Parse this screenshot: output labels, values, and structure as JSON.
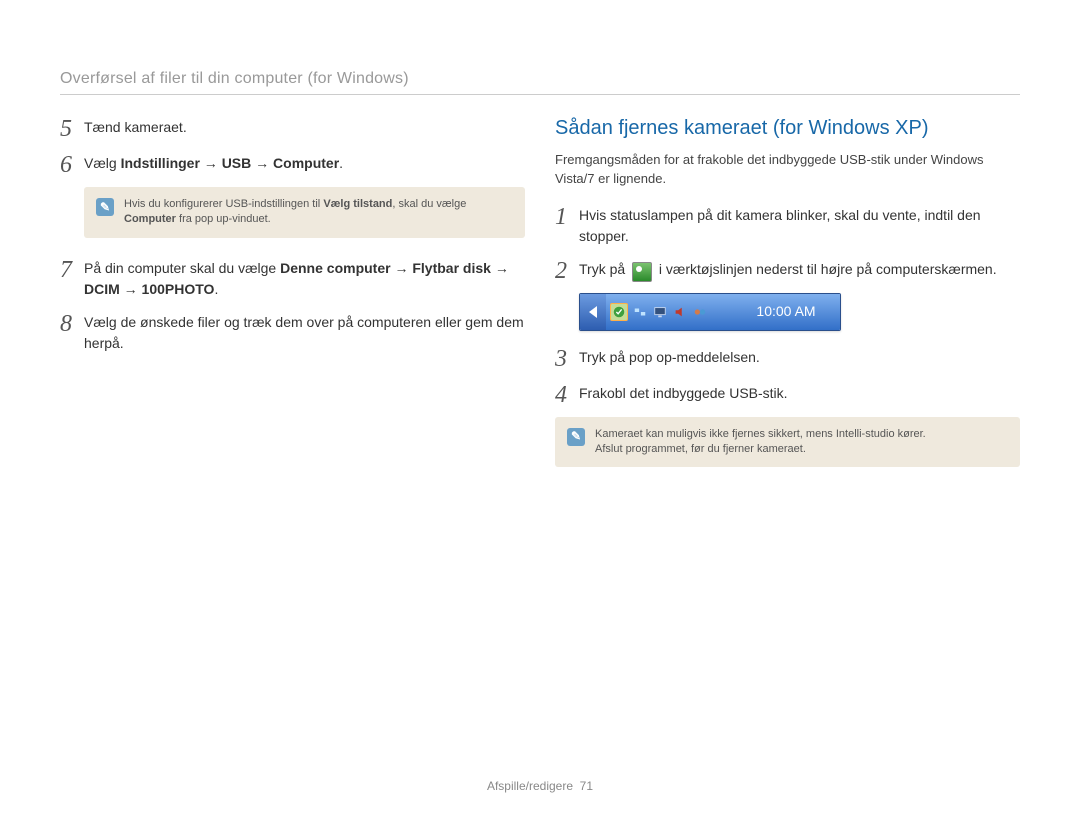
{
  "header": {
    "title": "Overførsel af filer til din computer (for Windows)"
  },
  "left": {
    "step5": {
      "num": "5",
      "text": "Tænd kameraet."
    },
    "step6": {
      "num": "6",
      "prefix": "Vælg ",
      "bold": "Indstillinger → USB → Computer",
      "suffix": "."
    },
    "note": {
      "line1a": "Hvis du konfigurerer USB-indstillingen til ",
      "line1b": "Vælg tilstand",
      "line1c": ", skal du vælge ",
      "line2a": "Computer",
      "line2b": " fra pop up-vinduet."
    },
    "step7": {
      "num": "7",
      "prefix": "På din computer skal du vælge ",
      "bold": "Denne computer → Flytbar disk → DCIM → 100PHOTO",
      "suffix": "."
    },
    "step8": {
      "num": "8",
      "text": "Vælg de ønskede filer og træk dem over på computeren eller gem dem herpå."
    }
  },
  "right": {
    "heading": "Sådan fjernes kameraet (for Windows XP)",
    "intro": "Fremgangsmåden for at frakoble det indbyggede USB-stik under Windows Vista/7 er lignende.",
    "step1": {
      "num": "1",
      "text": "Hvis statuslampen på dit kamera blinker, skal du vente, indtil den stopper."
    },
    "step2": {
      "num": "2",
      "prefix": "Tryk på ",
      "suffix": " i værktøjslinjen nederst til højre på computerskærmen."
    },
    "tray": {
      "time": "10:00 AM"
    },
    "step3": {
      "num": "3",
      "text": "Tryk på pop op-meddelelsen."
    },
    "step4": {
      "num": "4",
      "text": "Frakobl det indbyggede USB-stik."
    },
    "note": {
      "line1": "Kameraet kan muligvis ikke fjernes sikkert, mens Intelli-studio kører.",
      "line2": "Afslut programmet, før du fjerner kameraet."
    }
  },
  "footer": {
    "section": "Afspille/redigere",
    "page": "71"
  }
}
